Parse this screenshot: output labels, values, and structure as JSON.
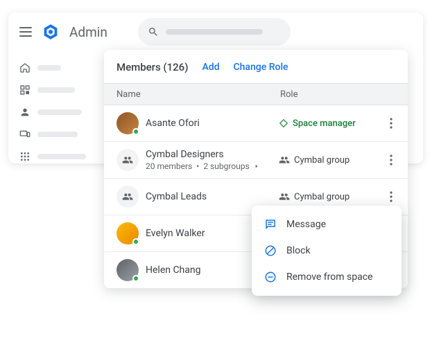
{
  "header": {
    "app_name": "Admin"
  },
  "panel": {
    "title": "Members (126)",
    "add_label": "Add",
    "change_role_label": "Change Role",
    "columns": {
      "name": "Name",
      "role": "Role"
    }
  },
  "members": [
    {
      "name": "Asante Ofori",
      "role": "Space manager",
      "role_type": "manager",
      "sub": ""
    },
    {
      "name": "Cymbal Designers",
      "role": "Cymbal group",
      "role_type": "group",
      "sub_a": "20 members",
      "sub_b": "2 subgroups"
    },
    {
      "name": "Cymbal Leads",
      "role": "Cymbal group",
      "role_type": "group",
      "sub": ""
    },
    {
      "name": "Evelyn Walker",
      "role": "",
      "role_type": "",
      "sub": ""
    },
    {
      "name": "Helen Chang",
      "role": "",
      "role_type": "",
      "sub": ""
    }
  ],
  "menu": {
    "message": "Message",
    "block": "Block",
    "remove": "Remove from space"
  }
}
